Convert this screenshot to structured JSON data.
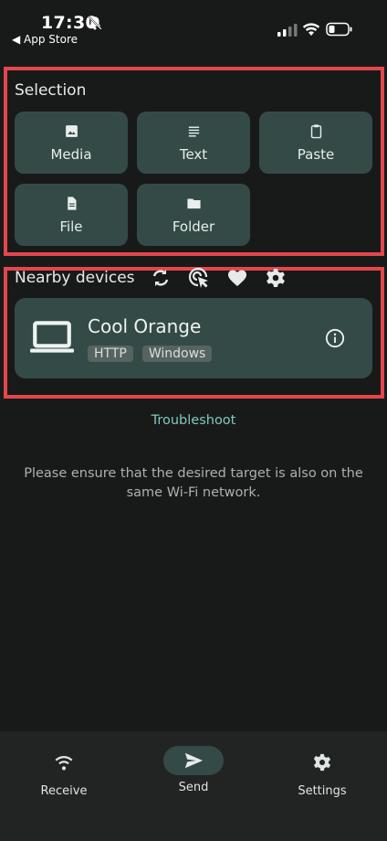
{
  "status_bar": {
    "time": "17:30",
    "back_label": "◀ App Store",
    "icons": [
      "bell-slash-icon",
      "signal-icon",
      "wifi-icon",
      "battery-icon"
    ]
  },
  "selection": {
    "title": "Selection",
    "tiles": [
      {
        "label": "Media",
        "icon": "image-icon"
      },
      {
        "label": "Text",
        "icon": "text-lines-icon"
      },
      {
        "label": "Paste",
        "icon": "clipboard-icon"
      },
      {
        "label": "File",
        "icon": "file-icon"
      },
      {
        "label": "Folder",
        "icon": "folder-icon"
      }
    ]
  },
  "nearby": {
    "title": "Nearby devices",
    "actions": [
      "refresh-icon",
      "cursor-select-icon",
      "heart-icon",
      "gear-icon"
    ],
    "device": {
      "name": "Cool Orange",
      "tags": [
        "HTTP",
        "Windows"
      ],
      "icon": "laptop-icon"
    }
  },
  "troubleshoot_label": "Troubleshoot",
  "note": "Please ensure that the desired target is also on the same Wi-Fi network.",
  "bottom_nav": {
    "items": [
      {
        "label": "Receive",
        "icon": "wifi-icon"
      },
      {
        "label": "Send",
        "icon": "send-icon",
        "selected": true
      },
      {
        "label": "Settings",
        "icon": "gear-icon"
      }
    ]
  },
  "colors": {
    "background": "#181a19",
    "tile": "#344a46",
    "highlight": "#e3464b",
    "accent_text": "#7fc9bf"
  }
}
